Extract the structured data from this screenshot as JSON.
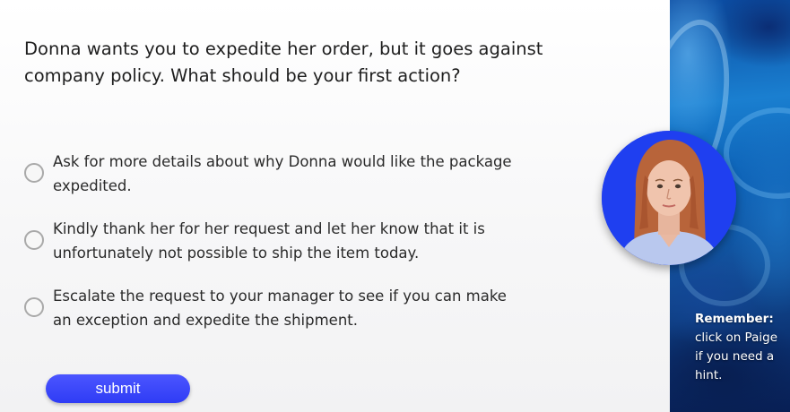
{
  "question": {
    "text": "Donna wants you to expedite her order, but it goes against company policy. What should be your first action?"
  },
  "options": [
    {
      "text": "Ask for more details about why Donna would like the package expedited.",
      "selected": false
    },
    {
      "text": "Kindly thank her for her request and let her know that it is unfortunately not possible to ship the item today.",
      "selected": false
    },
    {
      "text": "Escalate the request to your manager to see if you can make an exception and expedite the shipment.",
      "selected": false
    }
  ],
  "submit": {
    "label": "submit"
  },
  "hint": {
    "title": "Remember:",
    "body": "click on Paige if you need a hint."
  },
  "colors": {
    "accent": "#3a45ff",
    "avatar_bg": "#1f3ff0",
    "side_panel": "#0c5fb4"
  }
}
